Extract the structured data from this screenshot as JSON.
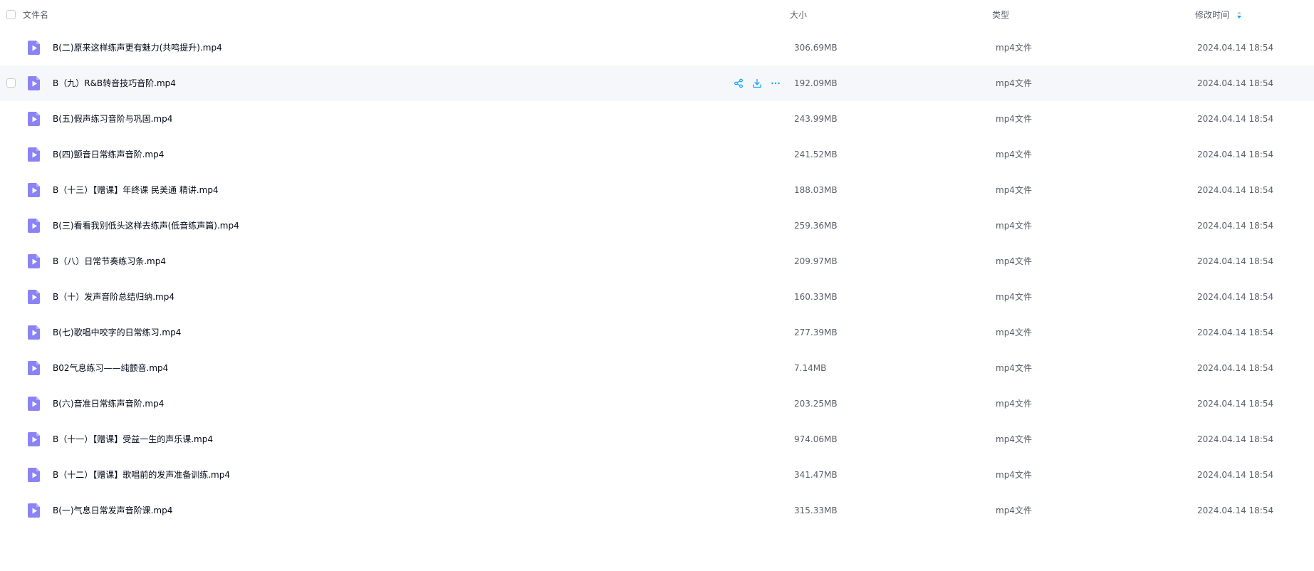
{
  "header": {
    "name_label": "文件名",
    "size_label": "大小",
    "type_label": "类型",
    "mtime_label": "修改时间"
  },
  "colors": {
    "accent": "#06a7ff",
    "icon_purple": "#8b83f5",
    "row_hover": "#f6f7fb",
    "text_primary": "#03081a",
    "text_secondary": "#5b5f6b"
  },
  "icons": {
    "file": "video-file-icon",
    "share": "share-icon",
    "download": "download-icon",
    "more": "more-icon",
    "sort": "sort-desc-icon"
  },
  "hovered_row_index": 1,
  "rows": [
    {
      "name": "B(二)原来这样练声更有魅力(共鸣提升).mp4",
      "size": "306.69MB",
      "type": "mp4文件",
      "mtime": "2024.04.14 18:54"
    },
    {
      "name": "B（九）R&B转音技巧音阶.mp4",
      "size": "192.09MB",
      "type": "mp4文件",
      "mtime": "2024.04.14 18:54"
    },
    {
      "name": "B(五)假声练习音阶与巩固.mp4",
      "size": "243.99MB",
      "type": "mp4文件",
      "mtime": "2024.04.14 18:54"
    },
    {
      "name": "B(四)颤音日常练声音阶.mp4",
      "size": "241.52MB",
      "type": "mp4文件",
      "mtime": "2024.04.14 18:54"
    },
    {
      "name": "B（十三）【赠课】年终课 民美通 精讲.mp4",
      "size": "188.03MB",
      "type": "mp4文件",
      "mtime": "2024.04.14 18:54"
    },
    {
      "name": "B(三)看看我别低头这样去练声(低音练声篇).mp4",
      "size": "259.36MB",
      "type": "mp4文件",
      "mtime": "2024.04.14 18:54"
    },
    {
      "name": "B（八）日常节奏练习条.mp4",
      "size": "209.97MB",
      "type": "mp4文件",
      "mtime": "2024.04.14 18:54"
    },
    {
      "name": "B（十）发声音阶总结归纳.mp4",
      "size": "160.33MB",
      "type": "mp4文件",
      "mtime": "2024.04.14 18:54"
    },
    {
      "name": "B(七)歌唱中咬字的日常练习.mp4",
      "size": "277.39MB",
      "type": "mp4文件",
      "mtime": "2024.04.14 18:54"
    },
    {
      "name": "B02气息练习——纯颤音.mp4",
      "size": "7.14MB",
      "type": "mp4文件",
      "mtime": "2024.04.14 18:54"
    },
    {
      "name": "B(六)音准日常练声音阶.mp4",
      "size": "203.25MB",
      "type": "mp4文件",
      "mtime": "2024.04.14 18:54"
    },
    {
      "name": "B（十一）【赠课】受益一生的声乐课.mp4",
      "size": "974.06MB",
      "type": "mp4文件",
      "mtime": "2024.04.14 18:54"
    },
    {
      "name": "B（十二）【赠课】歌唱前的发声准备训练.mp4",
      "size": "341.47MB",
      "type": "mp4文件",
      "mtime": "2024.04.14 18:54"
    },
    {
      "name": "B(一)气息日常发声音阶课.mp4",
      "size": "315.33MB",
      "type": "mp4文件",
      "mtime": "2024.04.14 18:54"
    }
  ]
}
